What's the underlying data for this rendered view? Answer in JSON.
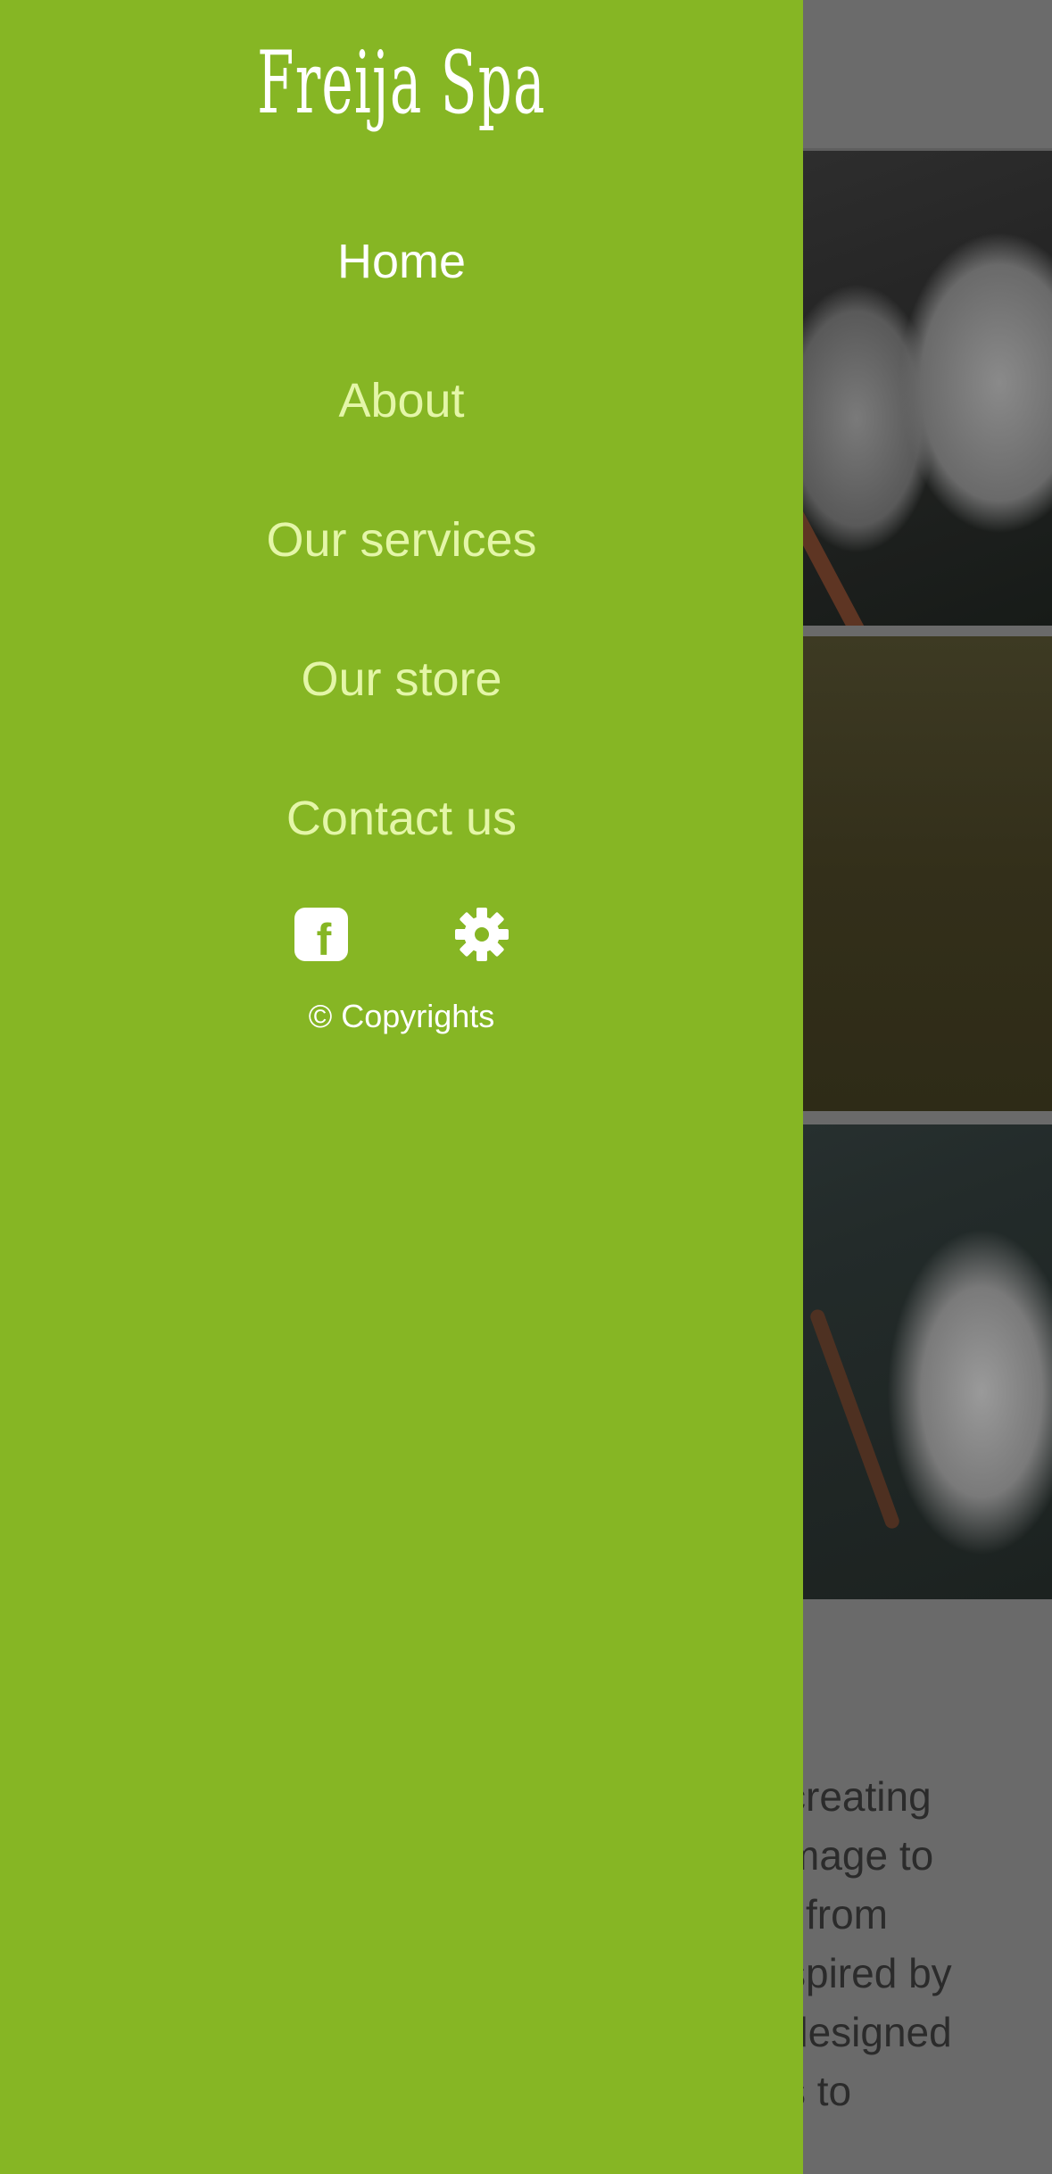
{
  "brand": {
    "name": "Freija Spa"
  },
  "nav": {
    "items": [
      {
        "label": "Home",
        "active": true
      },
      {
        "label": "About",
        "active": false
      },
      {
        "label": "Our services",
        "active": false
      },
      {
        "label": "Our store",
        "active": false
      },
      {
        "label": "Contact us",
        "active": false
      }
    ]
  },
  "social": {
    "icons": [
      "facebook-icon",
      "gear-icon"
    ]
  },
  "footer": {
    "copyright": "© Copyrights"
  },
  "background": {
    "body_text_fragments": [
      "creating",
      "mage to",
      "l from",
      "spired by",
      "designed",
      "s to"
    ]
  },
  "colors": {
    "drawer": "#86b624",
    "active_link": "#ffffff",
    "link": "#e4f6a8",
    "overlay": "#6a6a6a"
  }
}
